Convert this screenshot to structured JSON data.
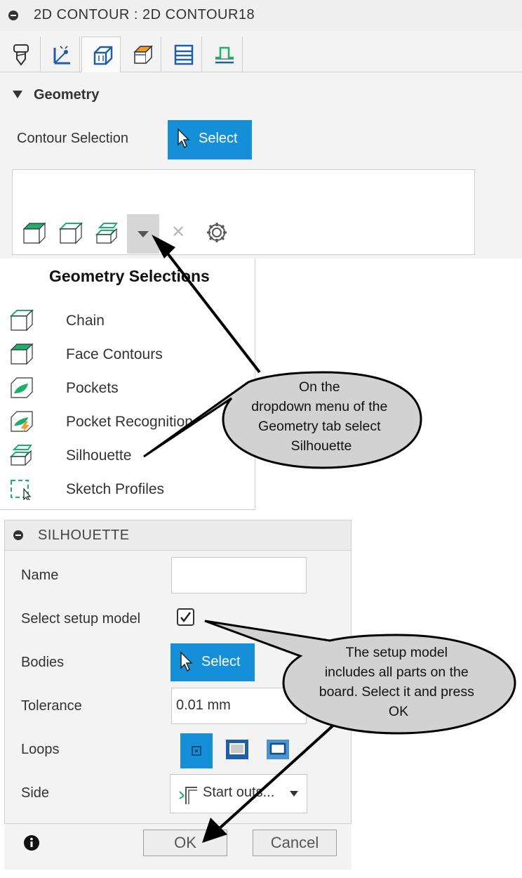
{
  "panel": {
    "title": "2D CONTOUR : 2D CONTOUR18",
    "tabs": [
      "tool-icon",
      "geometry-setup-icon",
      "geometry-icon",
      "heights-icon",
      "passes-icon",
      "linking-icon"
    ],
    "section_title": "Geometry",
    "contour_selection_label": "Contour Selection",
    "select_label": "Select",
    "selection_icons": [
      "face-contours-icon",
      "chain-icon",
      "silhouette-icon",
      "dropdown-arrow-icon",
      "clear-icon",
      "settings-icon"
    ]
  },
  "menu": {
    "title": "Geometry Selections",
    "items": [
      {
        "label": "Chain",
        "icon": "chain-icon"
      },
      {
        "label": "Face Contours",
        "icon": "face-contours-icon"
      },
      {
        "label": "Pockets",
        "icon": "pockets-icon"
      },
      {
        "label": "Pocket Recognition",
        "icon": "pocket-recognition-icon"
      },
      {
        "label": "Silhouette",
        "icon": "silhouette-icon"
      },
      {
        "label": "Sketch Profiles",
        "icon": "sketch-profiles-icon"
      }
    ]
  },
  "silhouette": {
    "title": "SILHOUETTE",
    "name_label": "Name",
    "name_value": "",
    "setup_model_label": "Select setup model",
    "setup_model_checked": true,
    "bodies_label": "Bodies",
    "bodies_select_label": "Select",
    "tolerance_label": "Tolerance",
    "tolerance_value": "0.01 mm",
    "loops_label": "Loops",
    "loops_options": [
      "loops-inner-icon",
      "loops-outer-icon",
      "loops-both-icon"
    ],
    "side_label": "Side",
    "side_value": "Start outs...",
    "ok_label": "OK",
    "cancel_label": "Cancel"
  },
  "callouts": {
    "top_lines": [
      "On the",
      "dropdown menu of the",
      "Geometry tab select",
      "Silhouette"
    ],
    "bottom_lines": [
      "The setup model",
      "includes all parts on the",
      "board.  Select it and press",
      "OK"
    ]
  },
  "colors": {
    "accent": "#1590d8",
    "panel_bg": "#f3f3f3",
    "callout_fill": "#d2d2d2",
    "icon_green": "#1bb06b"
  }
}
